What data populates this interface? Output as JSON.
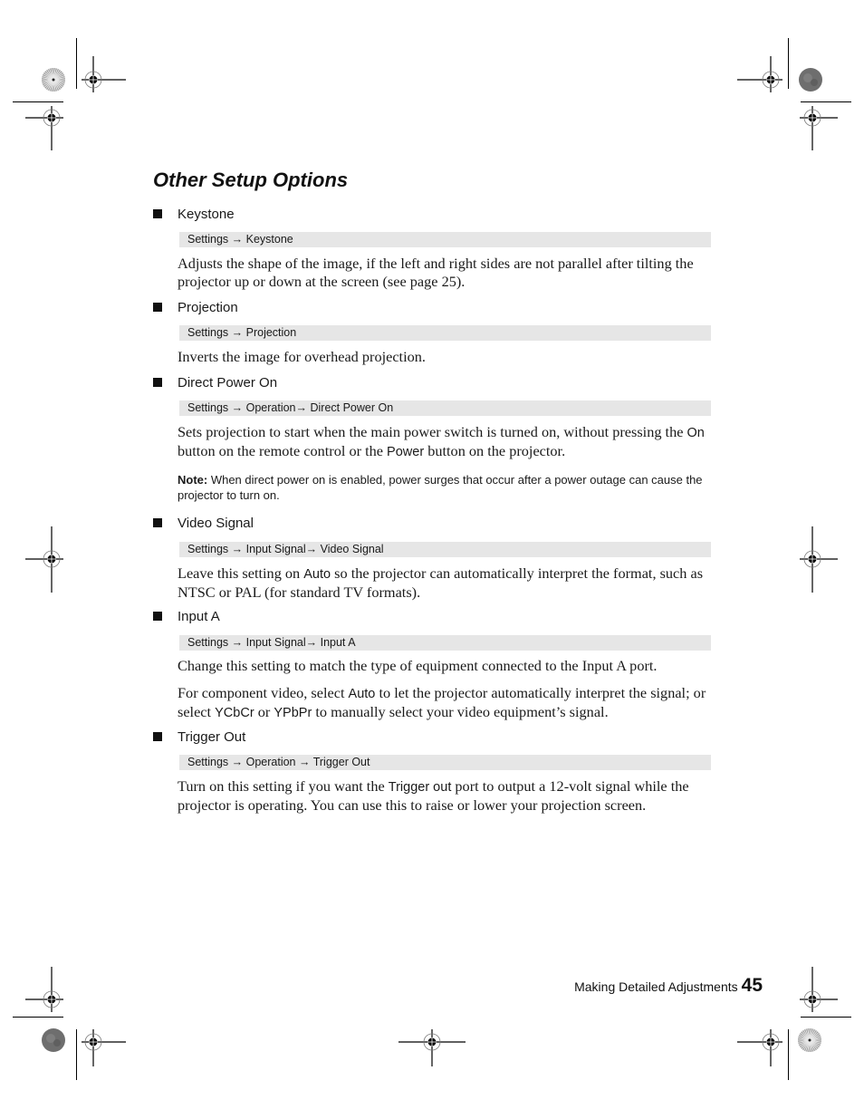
{
  "page": {
    "title": "Other Setup Options",
    "footer": {
      "chapter": "Making Detailed Adjustments",
      "page_number": "45"
    }
  },
  "sections": [
    {
      "heading": "Keystone",
      "path": "Settings → Keystone",
      "paragraphs": [
        {
          "parts": [
            "Adjusts the shape of the image, if the left and right sides are not parallel after tilting the projector up or down at the screen (see page 25)."
          ]
        }
      ]
    },
    {
      "heading": "Projection",
      "path": "Settings → Projection",
      "paragraphs": [
        {
          "parts": [
            "Inverts the image for overhead projection."
          ]
        }
      ]
    },
    {
      "heading": "Direct Power On",
      "path": "Settings → Operation→ Direct Power On",
      "paragraphs": [
        {
          "p1": "Sets projection to start when the main power switch is turned on, without pressing the ",
          "ui1": "On",
          "p2": " button on the remote control or the ",
          "ui2": "Power",
          "p3": " button on the projector."
        }
      ],
      "note": {
        "label": "Note:",
        "text": " When direct power on is enabled, power surges that occur after a power outage can cause the projector to turn on."
      }
    },
    {
      "heading": "Video Signal",
      "path": "Settings → Input Signal→ Video Signal",
      "paragraphs": [
        {
          "p1": "Leave this setting on ",
          "ui1": "Auto",
          "p2": " so the projector can automatically interpret the format, such as NTSC or PAL (for standard TV formats)."
        }
      ]
    },
    {
      "heading": "Input A",
      "path": "Settings → Input Signal→ Input A",
      "paragraphs": [
        {
          "p1": "Change this setting to match the type of equipment connected to the Input A port."
        },
        {
          "p1": "For component video, select ",
          "ui1": "Auto",
          "p2": " to let the projector automatically interpret the signal; or select ",
          "ui2": "YCbCr",
          "p3": " or ",
          "ui3": "YPbPr",
          "p4": " to manually select your video equipment’s signal."
        }
      ]
    },
    {
      "heading": "Trigger Out",
      "path": "Settings → Operation → Trigger Out",
      "paragraphs": [
        {
          "p1": "Turn on this setting if you want the ",
          "ui1": "Trigger out",
          "p2": " port to output a 12-volt signal while the projector is operating. You can use this to raise or lower your projection screen."
        }
      ]
    }
  ]
}
